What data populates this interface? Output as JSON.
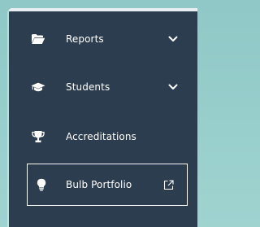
{
  "nav": {
    "items": [
      {
        "label": "Reports",
        "icon": "folder-open-icon",
        "expandable": true
      },
      {
        "label": "Students",
        "icon": "graduation-cap-icon",
        "expandable": true
      },
      {
        "label": "Accreditations",
        "icon": "trophy-icon",
        "expandable": false
      },
      {
        "label": "Bulb Portfolio",
        "icon": "lightbulb-icon",
        "external": true,
        "selected": true
      }
    ]
  },
  "colors": {
    "sidebar_bg": "#2c3d4f",
    "text": "#ffffff",
    "page_bg": "#9fd3d0"
  }
}
